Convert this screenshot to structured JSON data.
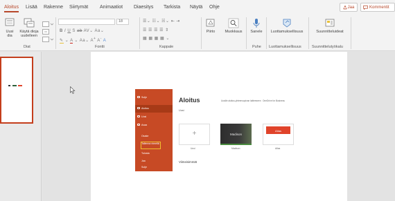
{
  "tabs": [
    "Aloitus",
    "Lisää",
    "Rakenne",
    "Siirtymät",
    "Animaatiot",
    "Diaesitys",
    "Tarkista",
    "Näytä",
    "Ohje"
  ],
  "share": {
    "label": "Jaa"
  },
  "comments": {
    "label": "Kommentit"
  },
  "ribbon": {
    "new_slide": [
      "Uusi",
      "dia"
    ],
    "reuse_slides": [
      "Käytä dioja",
      "uudelleen"
    ],
    "group_slides": "Diat",
    "font_size": "18",
    "group_font": "Fontti",
    "group_paragraph": "Kappale",
    "draw": "Piirto",
    "find": "Muokkaus",
    "dictate": "Sanele",
    "group_speech": "Puhe",
    "sensitivity": "Luottamuksellisuus",
    "group_sensitivity": "Luottamuksellisuus",
    "designer": "Suunnitteluideat",
    "group_designer": "Suunnittelutyökalu"
  },
  "embedded": {
    "sidebar": [
      "Sulje",
      "Aloitus",
      "Uusi",
      "Avaa",
      "Osake",
      "Tallenna nimellä",
      "Tulosta",
      "Jaa",
      "Sulje"
    ],
    "title": "Aloitus",
    "subtitle": "Uusi",
    "extensions_text": "Uusille aloitus-yhteensopivan laitteeseen",
    "onedrive_text": "OneDrive for Business",
    "templates": [
      "Uusi",
      "Madison",
      "Atlas"
    ],
    "madison_label": "Madison",
    "atlas_label": "Atlas",
    "recent": "Viimeisimmät"
  },
  "colors": {
    "accent": "#b7472a",
    "sidebar": "#c74a25",
    "thumb_border": "#c43e1c"
  }
}
